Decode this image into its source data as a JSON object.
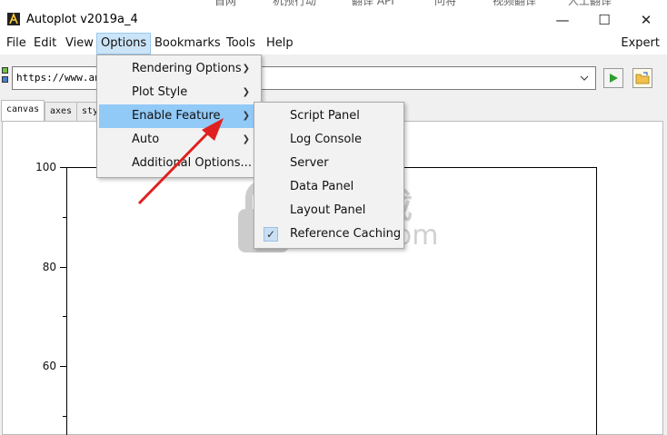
{
  "top_strip": [
    "首网",
    "机预行动",
    "翻译 API",
    "问将",
    "视频翻译",
    "人工翻译"
  ],
  "window": {
    "title": "Autoplot v2019a_4"
  },
  "menubar": {
    "items": [
      "File",
      "Edit",
      "View",
      "Options",
      "Bookmarks",
      "Tools",
      "Help"
    ],
    "right": "Expert"
  },
  "url": {
    "value": "https://www.anx"
  },
  "tabs": [
    "canvas",
    "axes",
    "sty"
  ],
  "options_menu": {
    "items": [
      {
        "label": "Rendering Options",
        "submenu": true
      },
      {
        "label": "Plot Style",
        "submenu": true
      },
      {
        "label": "Enable Feature",
        "submenu": true,
        "highlighted": true
      },
      {
        "label": "Auto",
        "submenu": true
      },
      {
        "label": "Additional Options...",
        "submenu": false
      }
    ]
  },
  "enable_feature_menu": {
    "items": [
      {
        "label": "Script Panel",
        "checked": false
      },
      {
        "label": "Log Console",
        "checked": false
      },
      {
        "label": "Server",
        "checked": false
      },
      {
        "label": "Data Panel",
        "checked": false
      },
      {
        "label": "Layout Panel",
        "checked": false
      },
      {
        "label": "Reference Caching",
        "checked": true
      }
    ]
  },
  "plot": {
    "y_ticks": [
      "100",
      "80",
      "60"
    ]
  },
  "watermark": {
    "cn": "安下载",
    "domain": "anxz.com"
  },
  "colors": {
    "accent": "#91c9f7",
    "arrow": "#e02020",
    "go": "#2e9e2e"
  }
}
